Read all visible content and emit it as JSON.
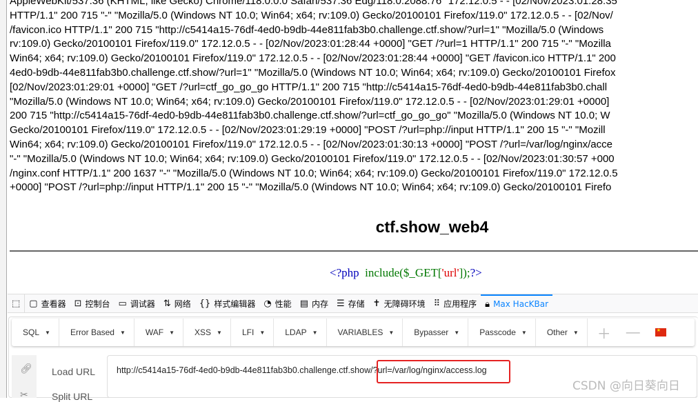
{
  "log_lines": [
    "AppleWebKit/537.36 (KHTML, like Gecko) Chrome/118.0.0.0 Safari/537.36 Edg/118.0.2088.76\" 172.12.0.5 - - [02/Nov/2023:01:28:35",
    "HTTP/1.1\" 200 715 \"-\" \"Mozilla/5.0 (Windows NT 10.0; Win64; x64; rv:109.0) Gecko/20100101 Firefox/119.0\" 172.12.0.5 - - [02/Nov/",
    "/favicon.ico HTTP/1.1\" 200 715 \"http://c5414a15-76df-4ed0-b9db-44e811fab3b0.challenge.ctf.show/?url=1\" \"Mozilla/5.0 (Windows",
    "rv:109.0) Gecko/20100101 Firefox/119.0\" 172.12.0.5 - - [02/Nov/2023:01:28:44 +0000] \"GET /?url=1 HTTP/1.1\" 200 715 \"-\" \"Mozilla",
    "Win64; x64; rv:109.0) Gecko/20100101 Firefox/119.0\" 172.12.0.5 - - [02/Nov/2023:01:28:44 +0000] \"GET /favicon.ico HTTP/1.1\" 200",
    "4ed0-b9db-44e811fab3b0.challenge.ctf.show/?url=1\" \"Mozilla/5.0 (Windows NT 10.0; Win64; x64; rv:109.0) Gecko/20100101 Firefox",
    "[02/Nov/2023:01:29:01 +0000] \"GET /?url=ctf_go_go_go HTTP/1.1\" 200 715 \"http://c5414a15-76df-4ed0-b9db-44e811fab3b0.chall",
    "\"Mozilla/5.0 (Windows NT 10.0; Win64; x64; rv:109.0) Gecko/20100101 Firefox/119.0\" 172.12.0.5 - - [02/Nov/2023:01:29:01 +0000]",
    "200 715 \"http://c5414a15-76df-4ed0-b9db-44e811fab3b0.challenge.ctf.show/?url=ctf_go_go_go\" \"Mozilla/5.0 (Windows NT 10.0; W",
    "Gecko/20100101 Firefox/119.0\" 172.12.0.5 - - [02/Nov/2023:01:29:19 +0000] \"POST /?url=php://input HTTP/1.1\" 200 15 \"-\" \"Mozill",
    "Win64; x64; rv:109.0) Gecko/20100101 Firefox/119.0\" 172.12.0.5 - - [02/Nov/2023:01:30:13 +0000] \"POST /?url=/var/log/nginx/acce",
    "\"-\" \"Mozilla/5.0 (Windows NT 10.0; Win64; x64; rv:109.0) Gecko/20100101 Firefox/119.0\" 172.12.0.5 - - [02/Nov/2023:01:30:57 +000",
    "/nginx.conf HTTP/1.1\" 200 1637 \"-\" \"Mozilla/5.0 (Windows NT 10.0; Win64; x64; rv:109.0) Gecko/20100101 Firefox/119.0\" 172.12.0.5",
    "+0000] \"POST /?url=php://input HTTP/1.1\" 200 15 \"-\" \"Mozilla/5.0 (Windows NT 10.0; Win64; x64; rv:109.0) Gecko/20100101 Firefo"
  ],
  "page": {
    "title": "ctf.show_web4",
    "code": {
      "open": "<?php",
      "fn": "include($_GET[",
      "str": "'url'",
      "close_fn": "]);",
      "close": "?>"
    }
  },
  "devtools": {
    "tabs": [
      {
        "label": "查看器",
        "icon": "inspector-icon"
      },
      {
        "label": "控制台",
        "icon": "console-icon"
      },
      {
        "label": "调试器",
        "icon": "debugger-icon"
      },
      {
        "label": "网络",
        "icon": "network-icon"
      },
      {
        "label": "样式编辑器",
        "icon": "style-editor-icon"
      },
      {
        "label": "性能",
        "icon": "performance-icon"
      },
      {
        "label": "内存",
        "icon": "memory-icon"
      },
      {
        "label": "存储",
        "icon": "storage-icon"
      },
      {
        "label": "无障碍环境",
        "icon": "accessibility-icon"
      },
      {
        "label": "应用程序",
        "icon": "application-icon"
      },
      {
        "label": "Max HacKBar",
        "icon": "lock-icon",
        "active": true
      }
    ],
    "accent": "#0a84ff"
  },
  "hackbar": {
    "menu": [
      "SQL",
      "Error Based",
      "WAF",
      "XSS",
      "LFI",
      "LDAP",
      "VARIABLES",
      "Bypasser",
      "Passcode",
      "Other"
    ],
    "load_url": "Load URL",
    "split_url": "Split URL",
    "url_value": "http://c5414a15-76df-4ed0-b9db-44e811fab3b0.challenge.ctf.show/?url=/var/log/nginx/access.log",
    "highlight_color": "#e52222"
  },
  "watermark": "CSDN @向日葵向日"
}
